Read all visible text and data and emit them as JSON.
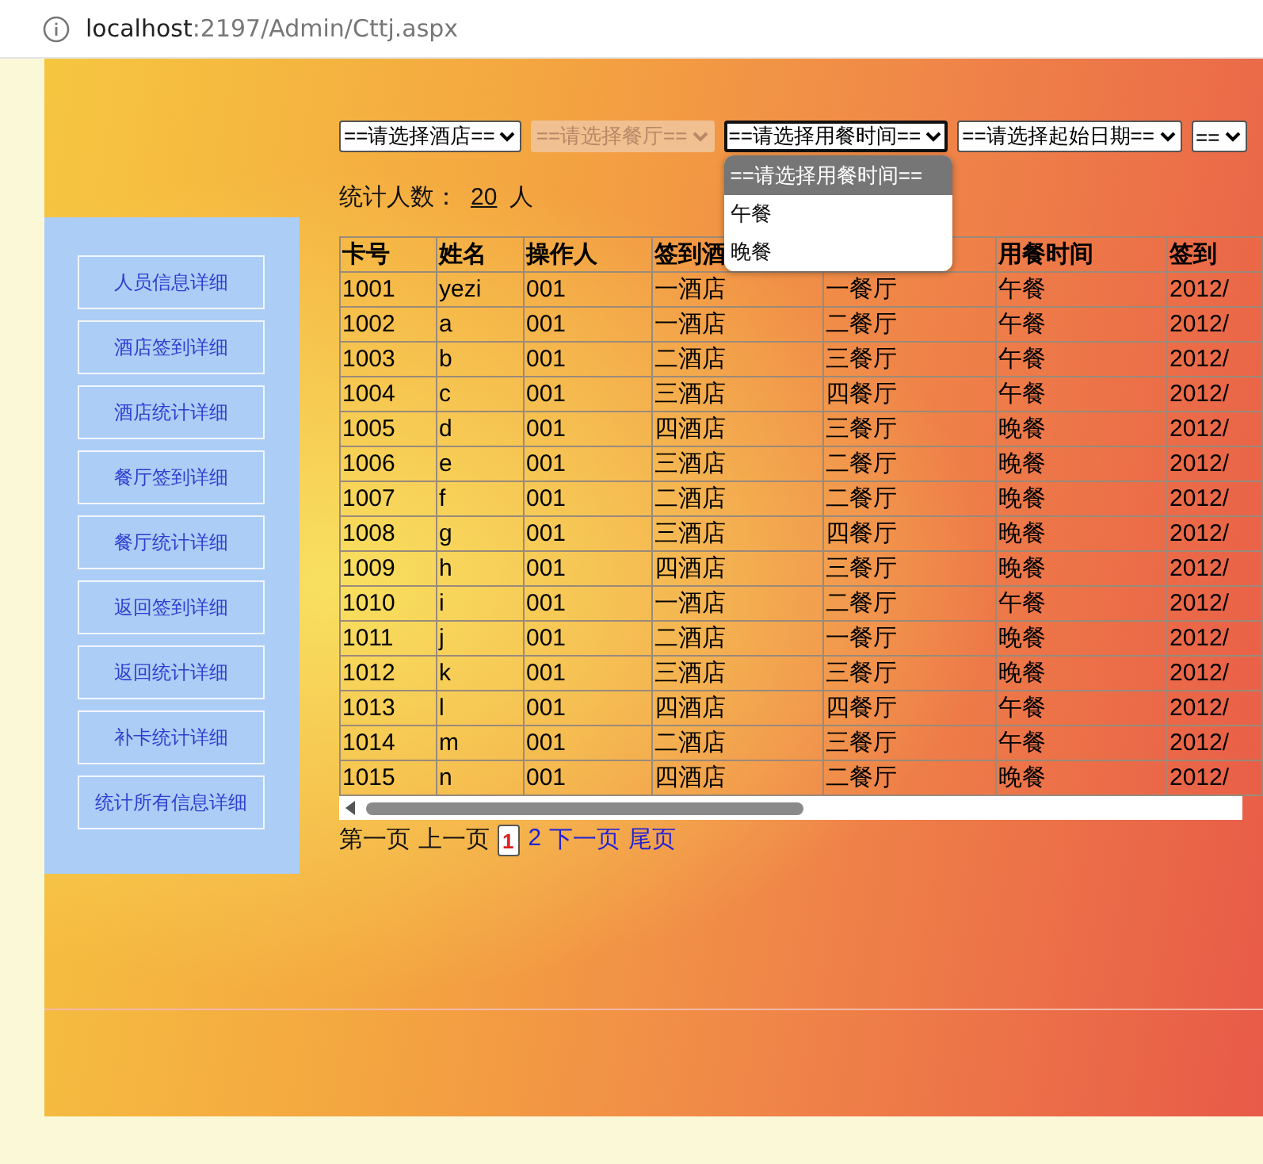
{
  "address_bar": {
    "host": "localhost",
    "path": ":2197/Admin/Cttj.aspx"
  },
  "sidebar": {
    "items": [
      {
        "label": "人员信息详细"
      },
      {
        "label": "酒店签到详细"
      },
      {
        "label": "酒店统计详细"
      },
      {
        "label": "餐厅签到详细"
      },
      {
        "label": "餐厅统计详细"
      },
      {
        "label": "返回签到详细"
      },
      {
        "label": "返回统计详细"
      },
      {
        "label": "补卡统计详细"
      },
      {
        "label": "统计所有信息详细"
      }
    ]
  },
  "filters": [
    {
      "value": "==请选择酒店==",
      "disabled": false,
      "expanded": false
    },
    {
      "value": "==请选择餐厅==",
      "disabled": true,
      "expanded": false
    },
    {
      "value": "==请选择用餐时间==",
      "disabled": false,
      "expanded": true,
      "options": [
        {
          "label": "==请选择用餐时间==",
          "selected": true
        },
        {
          "label": "午餐",
          "selected": false
        },
        {
          "label": "晚餐",
          "selected": false
        }
      ]
    },
    {
      "value": "==请选择起始日期==",
      "disabled": false,
      "expanded": false
    },
    {
      "value": "==",
      "disabled": false,
      "expanded": false
    }
  ],
  "count": {
    "label": "统计人数：",
    "value": "20",
    "unit": "人"
  },
  "table": {
    "columns": [
      {
        "label": "卡号"
      },
      {
        "label": "姓名"
      },
      {
        "label": "操作人"
      },
      {
        "label": "签到酒"
      },
      {},
      {
        "label": "用餐时间"
      },
      {
        "label": "签到"
      }
    ],
    "rows": [
      [
        "1001",
        "yezi",
        "001",
        "一酒店",
        "一餐厅",
        "午餐",
        "2012/"
      ],
      [
        "1002",
        "a",
        "001",
        "一酒店",
        "二餐厅",
        "午餐",
        "2012/"
      ],
      [
        "1003",
        "b",
        "001",
        "二酒店",
        "三餐厅",
        "午餐",
        "2012/"
      ],
      [
        "1004",
        "c",
        "001",
        "三酒店",
        "四餐厅",
        "午餐",
        "2012/"
      ],
      [
        "1005",
        "d",
        "001",
        "四酒店",
        "三餐厅",
        "晚餐",
        "2012/"
      ],
      [
        "1006",
        "e",
        "001",
        "三酒店",
        "二餐厅",
        "晚餐",
        "2012/"
      ],
      [
        "1007",
        "f",
        "001",
        "二酒店",
        "二餐厅",
        "晚餐",
        "2012/"
      ],
      [
        "1008",
        "g",
        "001",
        "三酒店",
        "四餐厅",
        "晚餐",
        "2012/"
      ],
      [
        "1009",
        "h",
        "001",
        "四酒店",
        "三餐厅",
        "晚餐",
        "2012/"
      ],
      [
        "1010",
        "i",
        "001",
        "一酒店",
        "二餐厅",
        "午餐",
        "2012/"
      ],
      [
        "1011",
        "j",
        "001",
        "二酒店",
        "一餐厅",
        "晚餐",
        "2012/"
      ],
      [
        "1012",
        "k",
        "001",
        "三酒店",
        "三餐厅",
        "晚餐",
        "2012/"
      ],
      [
        "1013",
        "l",
        "001",
        "四酒店",
        "四餐厅",
        "午餐",
        "2012/"
      ],
      [
        "1014",
        "m",
        "001",
        "二酒店",
        "三餐厅",
        "午餐",
        "2012/"
      ],
      [
        "1015",
        "n",
        "001",
        "四酒店",
        "二餐厅",
        "晚餐",
        "2012/"
      ]
    ]
  },
  "pager": [
    {
      "label": "第一页",
      "disabled": true,
      "selected": false
    },
    {
      "label": "上一页",
      "disabled": true,
      "selected": false
    },
    {
      "label": "1",
      "disabled": false,
      "selected": true
    },
    {
      "label": "2",
      "disabled": false,
      "selected": false
    },
    {
      "label": "下一页",
      "disabled": false,
      "selected": false
    },
    {
      "label": "尾页",
      "disabled": false,
      "selected": false
    }
  ]
}
